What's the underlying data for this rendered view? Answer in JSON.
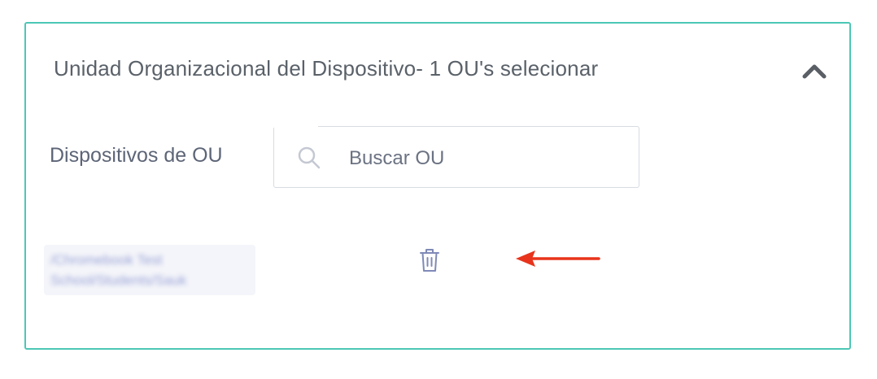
{
  "panel": {
    "title": "Unidad Organizacional del Dispositivo- 1 OU's selecionar",
    "collapse_icon": "chevron-up-icon"
  },
  "field": {
    "label": "Dispositivos de OU"
  },
  "search": {
    "icon": "search-icon",
    "placeholder": "Buscar OU",
    "value": ""
  },
  "selected_ous": [
    {
      "lines": [
        "/Chromebook Test",
        "School/Students/Sauk"
      ],
      "remove_icon": "trash-icon"
    }
  ],
  "annotation": {
    "icon": "arrow-left-icon",
    "color": "#e8341c"
  },
  "colors": {
    "border_accent": "#4cc7b5",
    "text": "#5a6169",
    "icon": "#7f8ab8"
  }
}
